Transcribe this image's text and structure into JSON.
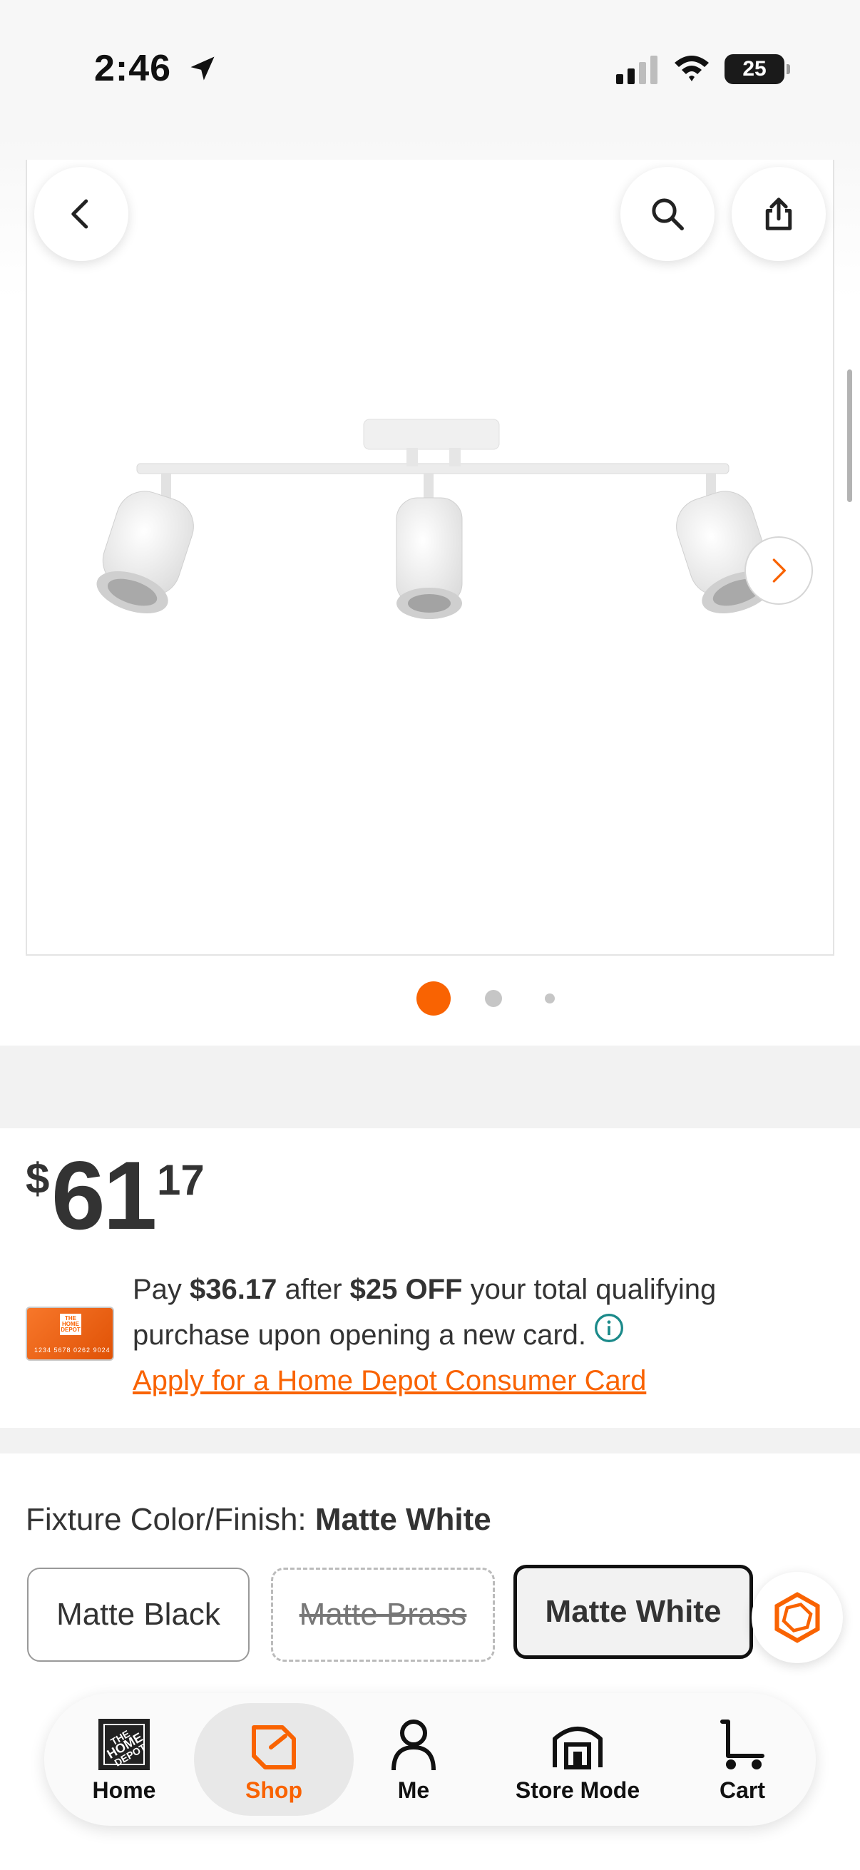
{
  "status_bar": {
    "time": "2:46",
    "battery": "25"
  },
  "price": {
    "currency": "$",
    "dollars": "61",
    "cents": "17"
  },
  "promo": {
    "text_1": "Pay ",
    "pay_amount": "$36.17",
    "text_2": " after ",
    "discount": "$25 OFF",
    "text_3": " your total qualifying purchase upon opening a new card.",
    "link": "Apply for a Home Depot Consumer Card",
    "card_logo": "THE HOME DEPOT",
    "card_number": "1234 5678 0262 9024"
  },
  "variant": {
    "label": "Fixture Color/Finish: ",
    "selected": "Matte White",
    "options": [
      "Matte Black",
      "Matte Brass",
      "Matte White"
    ]
  },
  "bottom_nav": {
    "home": "Home",
    "shop": "Shop",
    "me": "Me",
    "store_mode": "Store Mode",
    "cart": "Cart"
  },
  "colors": {
    "accent": "#f96302",
    "text": "#333333",
    "info": "#1b8a8a"
  },
  "gallery": {
    "pages": 3,
    "current": 1
  }
}
